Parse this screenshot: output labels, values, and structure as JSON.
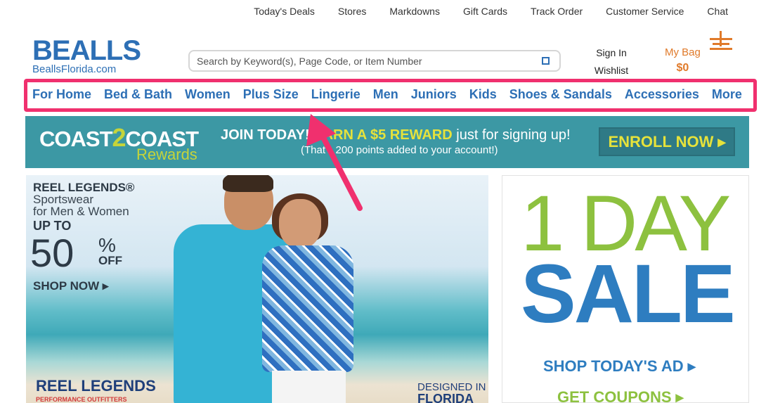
{
  "utility_nav": [
    "Today's Deals",
    "Stores",
    "Markdowns",
    "Gift Cards",
    "Track Order",
    "Customer Service",
    "Chat"
  ],
  "logo": {
    "brand": "BEALLS",
    "site": "BeallsFlorida.com"
  },
  "search": {
    "placeholder": "Search by Keyword(s), Page Code, or Item Number",
    "icon": "search-icon"
  },
  "account": {
    "sign_in": "Sign In",
    "wishlist": "Wishlist"
  },
  "bag": {
    "label": "My Bag",
    "amount": "$0"
  },
  "main_nav": [
    "For Home",
    "Bed & Bath",
    "Women",
    "Plus Size",
    "Lingerie",
    "Men",
    "Juniors",
    "Kids",
    "Shoes & Sandals",
    "Accessories",
    "More"
  ],
  "rewards": {
    "coast": "COAST",
    "two": "2",
    "coast2": "COAST",
    "rewards": "Rewards",
    "join": "JOIN TODAY!",
    "earn": "EARN A $5 REWARD",
    "earn_rest": "just for signing up!",
    "fine": "(That's 200 points added to your account!)",
    "cta": "ENROLL NOW ▸"
  },
  "promo": {
    "brand_line": "REEL LEGENDS®",
    "sub1": "Sportswear",
    "sub2": "for Men & Women",
    "up_to": "UP TO",
    "pct": "50",
    "pct_sign": "%",
    "off": "OFF",
    "cta": "SHOP NOW ▸",
    "logo": "REEL LEGENDS",
    "logo_sub": "PERFORMANCE OUTFITTERS",
    "designed": "DESIGNED IN",
    "florida": "FLORIDA"
  },
  "sale": {
    "line1": "1 DAY",
    "line2": "SALE",
    "link1": "SHOP TODAY'S AD ▸",
    "link2": "GET COUPONS ▸"
  },
  "colors": {
    "brand_blue": "#2d6fb5",
    "accent_orange": "#e07a2a",
    "highlight_pink": "#f0306e",
    "teal": "#3c98a4",
    "green": "#8dc13f"
  }
}
